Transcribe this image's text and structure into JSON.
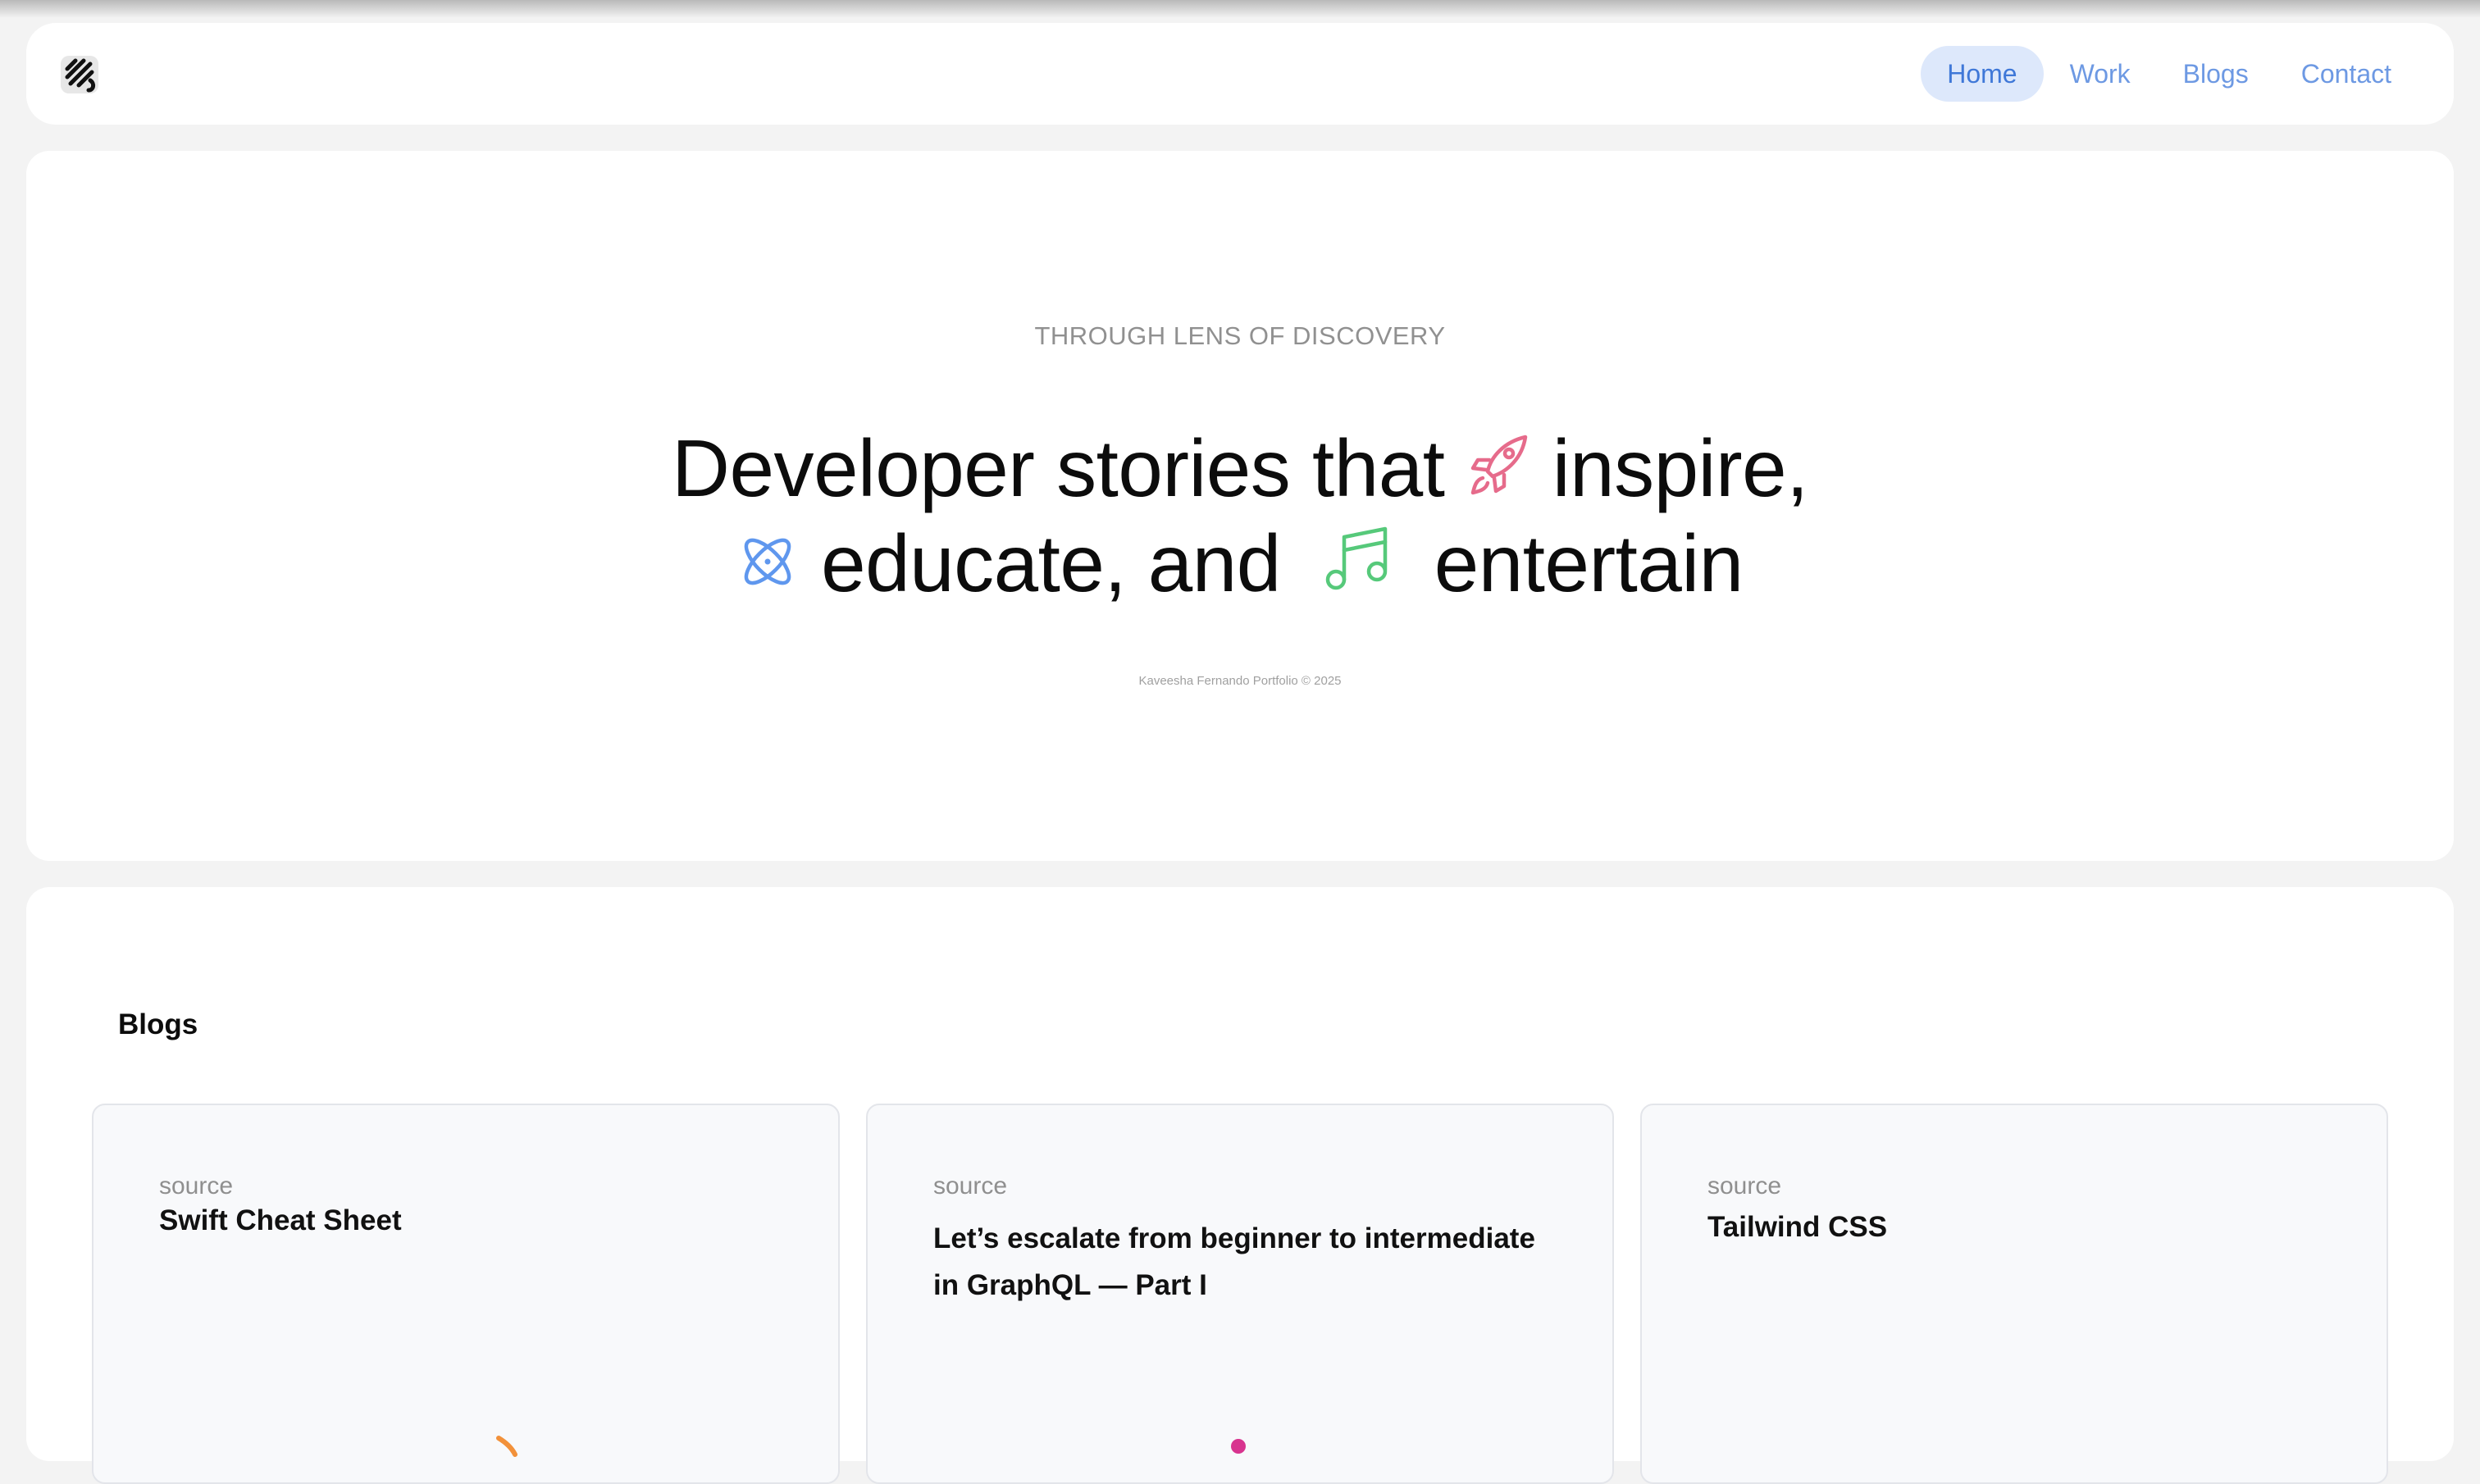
{
  "nav": {
    "items": [
      {
        "label": "Home",
        "active": true
      },
      {
        "label": "Work",
        "active": false
      },
      {
        "label": "Blogs",
        "active": false
      },
      {
        "label": "Contact",
        "active": false
      }
    ]
  },
  "hero": {
    "eyebrow": "THROUGH LENS OF DISCOVERY",
    "line1_a": "Developer stories that",
    "line1_b": "inspire,",
    "line2_a": "educate, and",
    "line2_b": "entertain",
    "icons": [
      "rocket-icon",
      "atom-icon",
      "music-note-icon"
    ],
    "copyright": "Kaveesha Fernando Portfolio © 2025"
  },
  "blogs": {
    "title": "Blogs",
    "cards": [
      {
        "source": "source",
        "title": "Swift Cheat Sheet"
      },
      {
        "source": "source",
        "title": "Let’s escalate from beginner to intermediate in GraphQL — Part I"
      },
      {
        "source": "source",
        "title": "Tailwind CSS"
      }
    ]
  },
  "colors": {
    "nav_active_bg": "#dde8fb",
    "nav_text": "#6d99e3",
    "rocket": "#e66b8b",
    "atom": "#5f97ee",
    "music": "#56c97a"
  }
}
